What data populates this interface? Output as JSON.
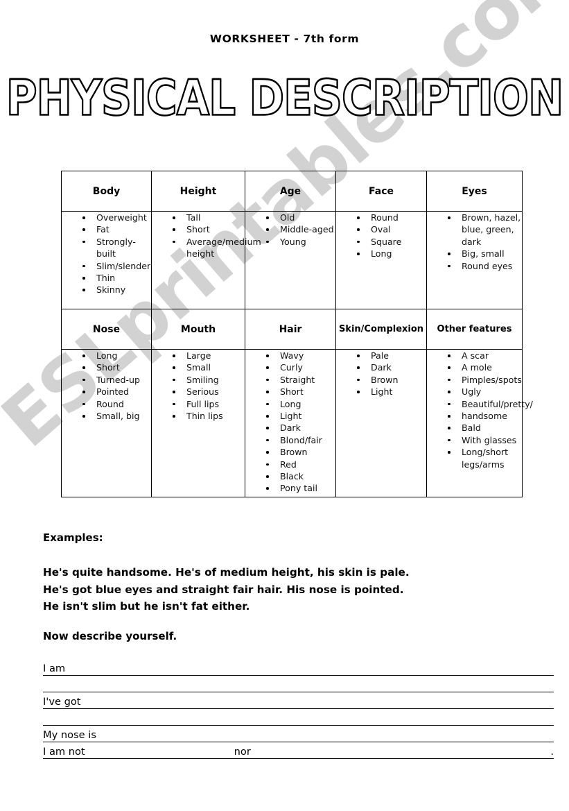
{
  "header": {
    "subtitle": "WORKSHEET - 7th form",
    "title": "PHYSICAL DESCRIPTION"
  },
  "watermark": {
    "text": "ESLprintables.com",
    "color": "#d2d2d2"
  },
  "table": {
    "rows": [
      {
        "columns": [
          {
            "header": "Body",
            "items": [
              "Overweight",
              "Fat",
              "Strongly-built",
              "Slim/slender",
              "Thin",
              "Skinny"
            ]
          },
          {
            "header": "Height",
            "items": [
              "Tall",
              "Short",
              "Average/medium"
            ],
            "continuations": [
              "height"
            ]
          },
          {
            "header": "Age",
            "items": [
              "Old",
              "Middle-aged",
              "Young"
            ]
          },
          {
            "header": "Face",
            "items": [
              "Round",
              "Oval",
              "Square",
              "Long"
            ]
          },
          {
            "header": "Eyes",
            "items": [
              "Brown, hazel,",
              "Big, small",
              "Round eyes"
            ],
            "wrap_after_first": "blue, green, dark"
          }
        ]
      },
      {
        "columns": [
          {
            "header": "Nose",
            "items": [
              "Long",
              "Short",
              "Turned-up",
              "Pointed",
              "Round",
              "Small, big"
            ]
          },
          {
            "header": "Mouth",
            "items": [
              "Large",
              "Small",
              "Smiling",
              "Serious",
              "Full lips",
              "Thin lips"
            ]
          },
          {
            "header": "Hair",
            "items": [
              "Wavy",
              "Curly",
              "Straight",
              "Short",
              "Long",
              "Light",
              "Dark",
              "Blond/fair",
              "Brown",
              "Red",
              "Black",
              "Pony tail"
            ]
          },
          {
            "header": "Skin/Complexion",
            "items": [
              "Pale",
              "Dark",
              "Brown",
              "Light"
            ]
          },
          {
            "header": "Other features",
            "items": [
              "A scar",
              "A mole",
              "Pimples/spots",
              "Ugly",
              "Beautiful/pretty/",
              "handsome",
              "Bald",
              "With glasses",
              "Long/short"
            ],
            "tail_continuation": "legs/arms"
          }
        ]
      }
    ]
  },
  "examples": {
    "label": "Examples:",
    "line1": "He's quite handsome. He's of medium height, his skin is pale.",
    "line2": "He's got blue eyes and straight fair hair. His nose is pointed.",
    "line3": "He isn't slim but he isn't fat either."
  },
  "task": {
    "prompt": "Now describe yourself.",
    "lines": [
      {
        "label": "I am",
        "mid": "",
        "end": ""
      },
      {
        "label": "",
        "mid": "",
        "end": ""
      },
      {
        "label": "I've got",
        "mid": "",
        "end": ""
      },
      {
        "label": "",
        "mid": "",
        "end": ""
      },
      {
        "label": "My nose is",
        "mid": "",
        "end": ""
      },
      {
        "label": "I am not",
        "mid": "nor",
        "end": "."
      }
    ]
  }
}
